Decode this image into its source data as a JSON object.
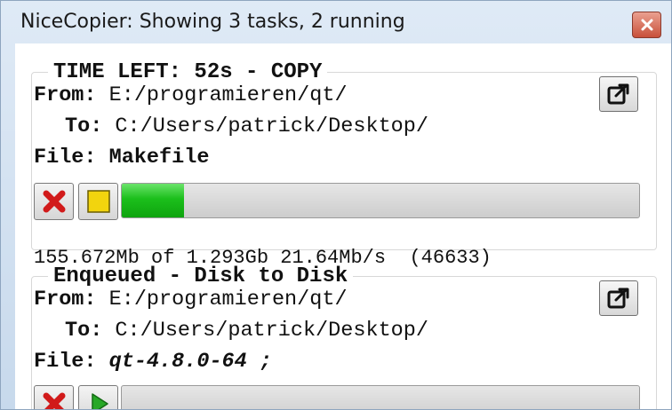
{
  "window": {
    "title": "NiceCopier: Showing 3 tasks, 2 running",
    "close_icon": "close-icon"
  },
  "tasks": [
    {
      "header": "TIME LEFT: 52s - COPY",
      "from_label": "From:",
      "from_value": "E:/programieren/qt/",
      "to_label": "To:",
      "to_value": "C:/Users/patrick/Desktop/",
      "file_label": "File:",
      "file_value": "Makefile",
      "open_icon": "open-external-icon",
      "cancel_icon": "red-x-icon",
      "pause_icon": "yellow-square-icon",
      "progress_percent": 12,
      "stats": "155.672Mb of 1.293Gb 21.64Mb/s  (46633)"
    },
    {
      "header": "Enqueued - Disk to Disk",
      "from_label": "From:",
      "from_value": "E:/programieren/qt/",
      "to_label": "To:",
      "to_value": "C:/Users/patrick/Desktop/",
      "file_label": "File:",
      "file_value": "qt-4.8.0-64 ;",
      "open_icon": "open-external-icon",
      "cancel_icon": "red-x-icon",
      "start_icon": "green-play-icon",
      "progress_percent": 0
    }
  ],
  "colors": {
    "progress_green": "#1bbf1b",
    "cancel_red": "#d11a1a",
    "pause_yellow": "#f2d40e",
    "play_green": "#27a827",
    "close_red": "#c8503a"
  }
}
